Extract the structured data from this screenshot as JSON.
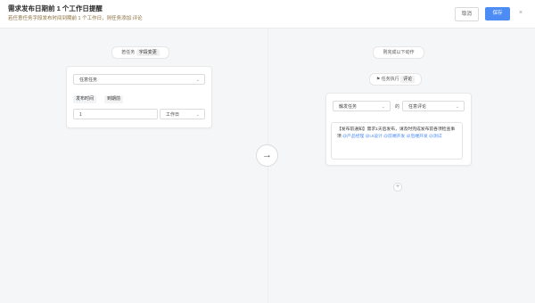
{
  "header": {
    "title": "需求发布日期前 1 个工作日提醒",
    "subtitle_prefix": "若任意任务字段发布时间到期前 1 个工作日，则任务添加",
    "subtitle_keyword": "评论",
    "cancel_label": "取消",
    "save_label": "保存",
    "close_glyph": "×"
  },
  "trigger": {
    "pill_prefix": "若任务",
    "pill_tag": "字段变更",
    "task_select": "任意任务",
    "field_tag": "发布时间",
    "condition_tag": "到期前",
    "number_value": "1",
    "unit_select": "工作日"
  },
  "action": {
    "header_pill": "则完成以下动作",
    "exec_prefix": "任务执行",
    "exec_tag": "评论",
    "target_select": "触发任务",
    "of_label": "的",
    "comment_target": "任意评论",
    "comment_text": "【发布前通知】需求1天后发布，请及时完成发布前各项检查事项",
    "mentions": [
      "@产品经理",
      "@UI设计",
      "@前端开发",
      "@后端开发",
      "@测试"
    ]
  },
  "icons": {
    "arrow": "arrow-right-icon",
    "plus": "plus-icon",
    "close": "close-icon",
    "chevron": "chevron-down-icon"
  }
}
